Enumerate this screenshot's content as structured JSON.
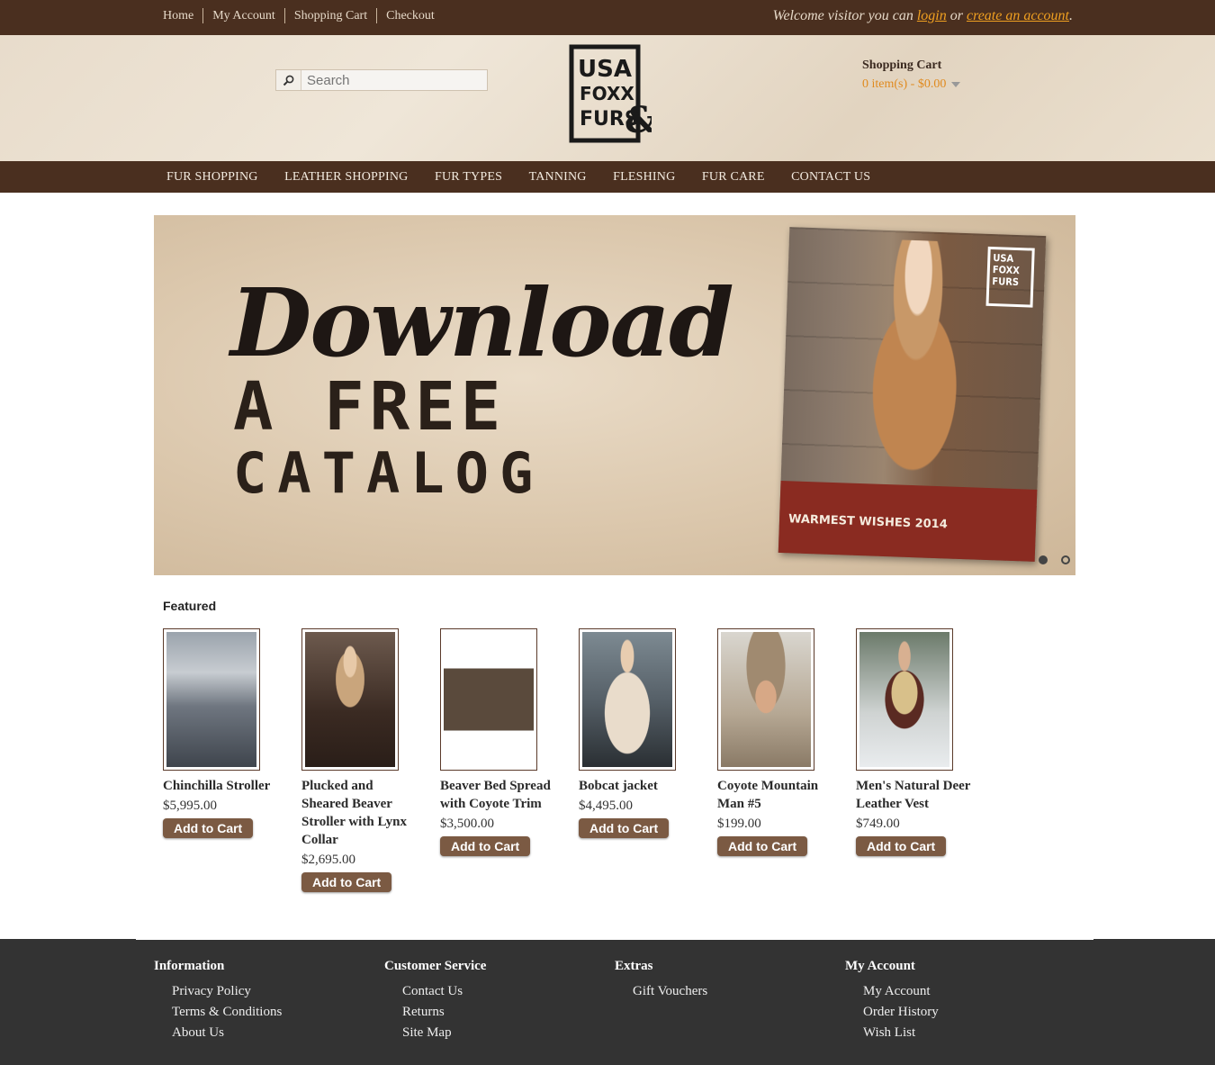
{
  "top_nav": {
    "links": [
      "Home",
      "My Account",
      "Shopping Cart",
      "Checkout"
    ],
    "welcome_prefix": "Welcome visitor you can",
    "login_label": "login",
    "or": "or",
    "create_label": "create an account",
    "period": "."
  },
  "header": {
    "search_placeholder": "Search",
    "logo_lines": [
      "USA",
      "FOXX",
      "FURS",
      "&"
    ],
    "cart_title": "Shopping Cart",
    "cart_summary": "0 item(s) - $0.00"
  },
  "main_nav": [
    "FUR SHOPPING",
    "LEATHER SHOPPING",
    "FUR TYPES",
    "TANNING",
    "FLESHING",
    "FUR CARE",
    "CONTACT US"
  ],
  "banner": {
    "line1": "Download",
    "line2": "A FREE",
    "line3": "CATALOG",
    "catalog_caption": "WARMEST WISHES 2014",
    "catalog_logo": "USA FOXX FURS",
    "active_slide": 2,
    "slide_count": 2
  },
  "featured": {
    "title": "Featured",
    "add_to_cart": "Add to Cart",
    "products": [
      {
        "name": "Chinchilla Stroller",
        "price": "$5,995.00",
        "image": "chinchilla-coat-photo"
      },
      {
        "name": "Plucked and Sheared Beaver Stroller with Lynx Collar",
        "price": "$2,695.00",
        "image": "beaver-coat-photo"
      },
      {
        "name": "Beaver Bed Spread with Coyote Trim",
        "price": "$3,500.00",
        "image": "fur-bedspread-photo"
      },
      {
        "name": "Bobcat jacket",
        "price": "$4,495.00",
        "image": "bobcat-jacket-photo"
      },
      {
        "name": "Coyote Mountain Man #5",
        "price": "$199.00",
        "image": "coyote-hat-photo"
      },
      {
        "name": "Men's Natural Deer Leather Vest",
        "price": "$749.00",
        "image": "leather-vest-photo"
      }
    ]
  },
  "footer": {
    "columns": [
      {
        "title": "Information",
        "links": [
          "Privacy Policy",
          "Terms & Conditions",
          "About Us"
        ]
      },
      {
        "title": "Customer Service",
        "links": [
          "Contact Us",
          "Returns",
          "Site Map"
        ]
      },
      {
        "title": "Extras",
        "links": [
          "Gift Vouchers"
        ]
      },
      {
        "title": "My Account",
        "links": [
          "My Account",
          "Order History",
          "Wish List"
        ]
      }
    ]
  },
  "colors": {
    "brown_bar": "#4a2f1f",
    "button": "#7b5a43",
    "link_orange": "#f0a020",
    "footer_bg": "#333333"
  }
}
